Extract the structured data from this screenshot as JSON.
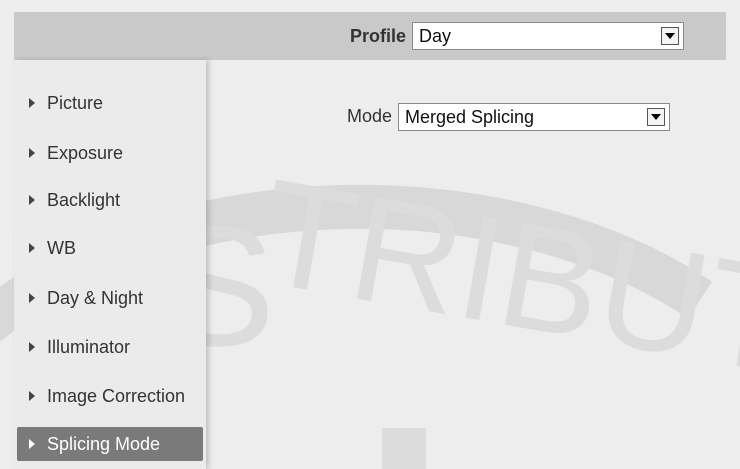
{
  "header": {
    "profile_label": "Profile",
    "profile_value": "Day"
  },
  "sidebar": {
    "items": [
      {
        "label": "Picture"
      },
      {
        "label": "Exposure"
      },
      {
        "label": "Backlight"
      },
      {
        "label": "WB"
      },
      {
        "label": "Day & Night"
      },
      {
        "label": "Illuminator"
      },
      {
        "label": "Image Correction"
      },
      {
        "label": "Splicing Mode",
        "active": true
      }
    ]
  },
  "main": {
    "mode_label": "Mode",
    "mode_value": "Merged Splicing"
  },
  "watermark": {
    "text": "DISTRIBUT"
  },
  "colors": {
    "topbar": "#c9c9c9",
    "active_item": "#7a7a7a",
    "background": "#ededed"
  }
}
